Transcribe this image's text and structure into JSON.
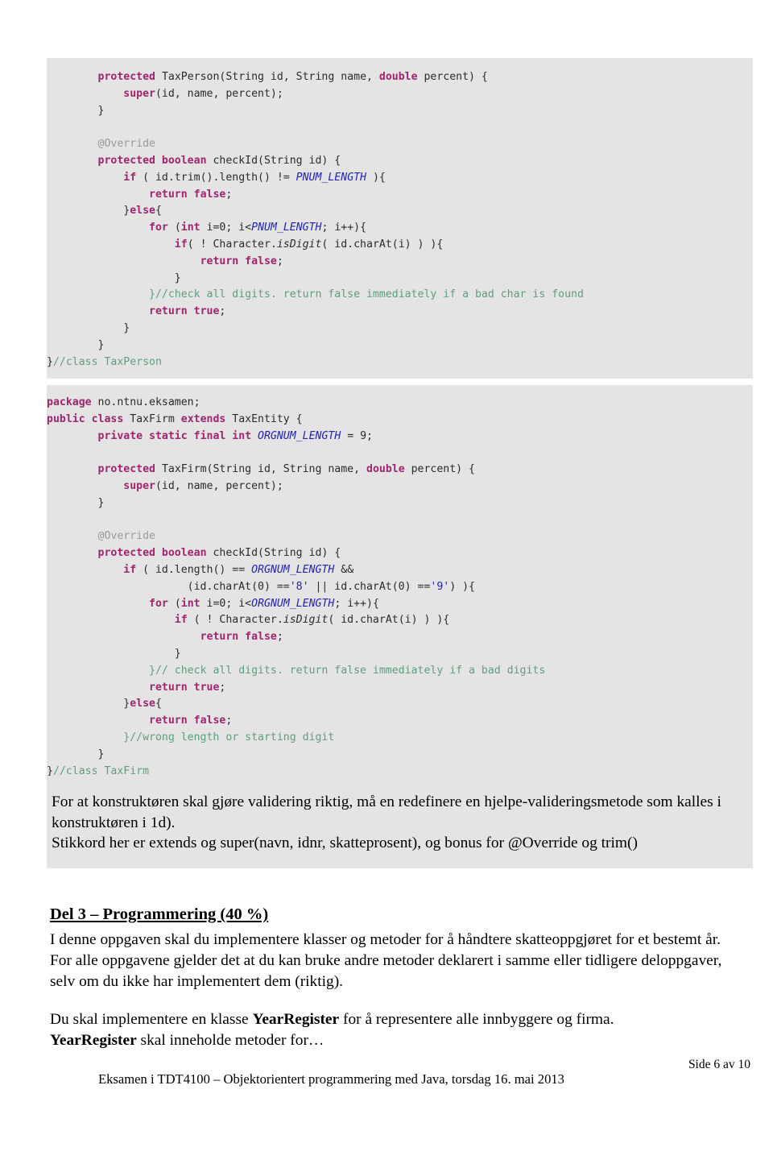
{
  "document": {
    "footer": {
      "page_label": "Side 6 av 10",
      "exam_line": "Eksamen i TDT4100 – Objektorientert programmering med Java, torsdag 16. mai 2013"
    },
    "colors": {
      "code_background": "#e4e4e4",
      "keyword": "#a0246e",
      "comment": "#5f9e7d",
      "annotation": "#9a9a9a",
      "constant": "#2222bb",
      "literal": "#2222bb",
      "plain": "#2b2b2b",
      "page_background": "#ffffff"
    }
  },
  "code_block_1": {
    "language": "java",
    "lines": [
      [
        {
          "t": "        ",
          "c": "pln"
        },
        {
          "t": "protected",
          "c": "kw"
        },
        {
          "t": " TaxPerson(String id, String name, ",
          "c": "pln"
        },
        {
          "t": "double",
          "c": "kw"
        },
        {
          "t": " percent) {",
          "c": "pln"
        }
      ],
      [
        {
          "t": "            ",
          "c": "pln"
        },
        {
          "t": "super",
          "c": "kw"
        },
        {
          "t": "(id, name, percent);",
          "c": "pln"
        }
      ],
      [
        {
          "t": "        }",
          "c": "pln"
        }
      ],
      [
        {
          "t": "",
          "c": "pln"
        }
      ],
      [
        {
          "t": "        ",
          "c": "pln"
        },
        {
          "t": "@Override",
          "c": "ann"
        }
      ],
      [
        {
          "t": "        ",
          "c": "pln"
        },
        {
          "t": "protected boolean",
          "c": "kw"
        },
        {
          "t": " checkId(String id) {",
          "c": "pln"
        }
      ],
      [
        {
          "t": "            ",
          "c": "pln"
        },
        {
          "t": "if",
          "c": "kw"
        },
        {
          "t": " ( id.trim().length() != ",
          "c": "pln"
        },
        {
          "t": "PNUM_LENGTH",
          "c": "cst"
        },
        {
          "t": " ){",
          "c": "pln"
        }
      ],
      [
        {
          "t": "                ",
          "c": "pln"
        },
        {
          "t": "return false",
          "c": "kw"
        },
        {
          "t": ";",
          "c": "pln"
        }
      ],
      [
        {
          "t": "            }",
          "c": "pln"
        },
        {
          "t": "else",
          "c": "kw"
        },
        {
          "t": "{",
          "c": "pln"
        }
      ],
      [
        {
          "t": "                ",
          "c": "pln"
        },
        {
          "t": "for",
          "c": "kw"
        },
        {
          "t": " (",
          "c": "pln"
        },
        {
          "t": "int",
          "c": "kw"
        },
        {
          "t": " i=0; i<",
          "c": "pln"
        },
        {
          "t": "PNUM_LENGTH",
          "c": "cst"
        },
        {
          "t": "; i++){",
          "c": "pln"
        }
      ],
      [
        {
          "t": "                    ",
          "c": "pln"
        },
        {
          "t": "if",
          "c": "kw"
        },
        {
          "t": "( ! Character.",
          "c": "pln"
        },
        {
          "t": "isDigit",
          "c": "mth"
        },
        {
          "t": "( id.charAt(i) ) ){",
          "c": "pln"
        }
      ],
      [
        {
          "t": "                        ",
          "c": "pln"
        },
        {
          "t": "return false",
          "c": "kw"
        },
        {
          "t": ";",
          "c": "pln"
        }
      ],
      [
        {
          "t": "                    }",
          "c": "pln"
        }
      ],
      [
        {
          "t": "                ",
          "c": "pln"
        },
        {
          "t": "}//check all digits. return false immediately if a bad char is found",
          "c": "cmt"
        }
      ],
      [
        {
          "t": "                ",
          "c": "pln"
        },
        {
          "t": "return true",
          "c": "kw"
        },
        {
          "t": ";",
          "c": "pln"
        }
      ],
      [
        {
          "t": "            }",
          "c": "pln"
        }
      ],
      [
        {
          "t": "        }",
          "c": "pln"
        }
      ],
      [
        {
          "t": "}",
          "c": "pln"
        },
        {
          "t": "//class TaxPerson",
          "c": "cmt"
        }
      ]
    ]
  },
  "code_block_2": {
    "language": "java",
    "lines": [
      [
        {
          "t": "package",
          "c": "kw"
        },
        {
          "t": " no.ntnu.eksamen;",
          "c": "pln"
        }
      ],
      [
        {
          "t": "public class",
          "c": "kw"
        },
        {
          "t": " TaxFirm ",
          "c": "pln"
        },
        {
          "t": "extends",
          "c": "kw"
        },
        {
          "t": " TaxEntity {",
          "c": "pln"
        }
      ],
      [
        {
          "t": "        ",
          "c": "pln"
        },
        {
          "t": "private static final int",
          "c": "kw"
        },
        {
          "t": " ",
          "c": "pln"
        },
        {
          "t": "ORGNUM_LENGTH",
          "c": "cst"
        },
        {
          "t": " = 9;",
          "c": "pln"
        }
      ],
      [
        {
          "t": "",
          "c": "pln"
        }
      ],
      [
        {
          "t": "        ",
          "c": "pln"
        },
        {
          "t": "protected",
          "c": "kw"
        },
        {
          "t": " TaxFirm(String id, String name, ",
          "c": "pln"
        },
        {
          "t": "double",
          "c": "kw"
        },
        {
          "t": " percent) {",
          "c": "pln"
        }
      ],
      [
        {
          "t": "            ",
          "c": "pln"
        },
        {
          "t": "super",
          "c": "kw"
        },
        {
          "t": "(id, name, percent);",
          "c": "pln"
        }
      ],
      [
        {
          "t": "        }",
          "c": "pln"
        }
      ],
      [
        {
          "t": "",
          "c": "pln"
        }
      ],
      [
        {
          "t": "        ",
          "c": "pln"
        },
        {
          "t": "@Override",
          "c": "ann"
        }
      ],
      [
        {
          "t": "        ",
          "c": "pln"
        },
        {
          "t": "protected boolean",
          "c": "kw"
        },
        {
          "t": " checkId(String id) {",
          "c": "pln"
        }
      ],
      [
        {
          "t": "            ",
          "c": "pln"
        },
        {
          "t": "if",
          "c": "kw"
        },
        {
          "t": " ( id.length() == ",
          "c": "pln"
        },
        {
          "t": "ORGNUM_LENGTH",
          "c": "cst"
        },
        {
          "t": " &&",
          "c": "pln"
        }
      ],
      [
        {
          "t": "                      (id.charAt(0) ==",
          "c": "pln"
        },
        {
          "t": "'8'",
          "c": "lit"
        },
        {
          "t": " || id.charAt(0) ==",
          "c": "pln"
        },
        {
          "t": "'9'",
          "c": "lit"
        },
        {
          "t": ") ){",
          "c": "pln"
        }
      ],
      [
        {
          "t": "                ",
          "c": "pln"
        },
        {
          "t": "for",
          "c": "kw"
        },
        {
          "t": " (",
          "c": "pln"
        },
        {
          "t": "int",
          "c": "kw"
        },
        {
          "t": " i=0; i<",
          "c": "pln"
        },
        {
          "t": "ORGNUM_LENGTH",
          "c": "cst"
        },
        {
          "t": "; i++){",
          "c": "pln"
        }
      ],
      [
        {
          "t": "                    ",
          "c": "pln"
        },
        {
          "t": "if",
          "c": "kw"
        },
        {
          "t": " ( ! Character.",
          "c": "pln"
        },
        {
          "t": "isDigit",
          "c": "mth"
        },
        {
          "t": "( id.charAt(i) ) ){",
          "c": "pln"
        }
      ],
      [
        {
          "t": "                        ",
          "c": "pln"
        },
        {
          "t": "return false",
          "c": "kw"
        },
        {
          "t": ";",
          "c": "pln"
        }
      ],
      [
        {
          "t": "                    }",
          "c": "pln"
        }
      ],
      [
        {
          "t": "                ",
          "c": "pln"
        },
        {
          "t": "}// check all digits. return false immediately if a bad digits",
          "c": "cmt"
        }
      ],
      [
        {
          "t": "                ",
          "c": "pln"
        },
        {
          "t": "return true",
          "c": "kw"
        },
        {
          "t": ";",
          "c": "pln"
        }
      ],
      [
        {
          "t": "            }",
          "c": "pln"
        },
        {
          "t": "else",
          "c": "kw"
        },
        {
          "t": "{",
          "c": "pln"
        }
      ],
      [
        {
          "t": "                ",
          "c": "pln"
        },
        {
          "t": "return false",
          "c": "kw"
        },
        {
          "t": ";",
          "c": "pln"
        }
      ],
      [
        {
          "t": "            ",
          "c": "pln"
        },
        {
          "t": "}//wrong length or starting digit",
          "c": "cmt"
        }
      ],
      [
        {
          "t": "        }",
          "c": "pln"
        }
      ],
      [
        {
          "t": "}",
          "c": "pln"
        },
        {
          "t": "//class TaxFirm",
          "c": "cmt"
        }
      ]
    ]
  },
  "solution_note": {
    "paragraph_1": "For at konstruktøren skal gjøre validering riktig, må en redefinere en hjelpe-valideringsmetode som kalles i konstruktøren i 1d).",
    "paragraph_2": "Stikkord her er extends og super(navn, idnr, skatteprosent), og bonus for @Override og trim()"
  },
  "part3": {
    "heading": "Del 3 – Programmering (40 %)",
    "intro": "I denne oppgaven skal du implementere klasser og metoder for å håndtere skatteoppgjøret for et bestemt år. For alle oppgavene gjelder det at du kan bruke andre metoder deklarert i samme eller tidligere deloppgaver, selv om du ikke har implementert dem (riktig).",
    "yearregister_line1_pre": "Du skal implementere en klasse ",
    "yearregister_line1_bold": "YearRegister",
    "yearregister_line1_post": " for å representere alle innbyggere og firma.",
    "yearregister_line2_bold": "YearRegister",
    "yearregister_line2_post": " skal inneholde metoder for…"
  }
}
